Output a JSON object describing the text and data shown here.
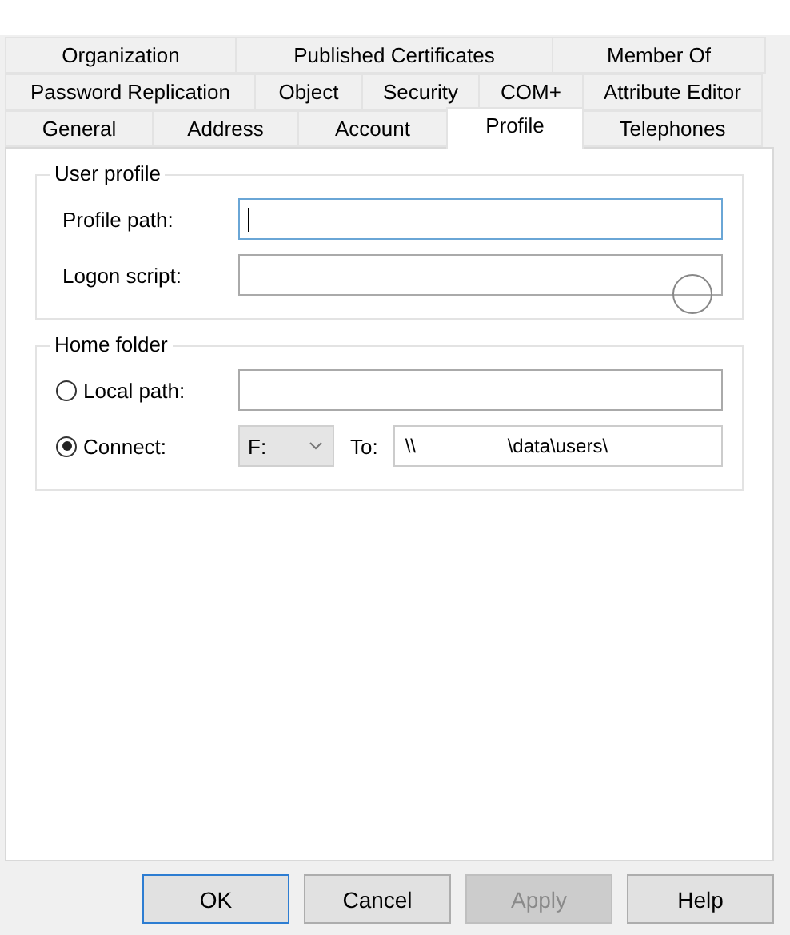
{
  "tab_rows": [
    [
      {
        "label": "Organization",
        "selected": false
      },
      {
        "label": "Published Certificates",
        "selected": false
      },
      {
        "label": "Member Of",
        "selected": false
      }
    ],
    [
      {
        "label": "Password Replication",
        "selected": false
      },
      {
        "label": "Object",
        "selected": false
      },
      {
        "label": "Security",
        "selected": false
      },
      {
        "label": "COM+",
        "selected": false
      },
      {
        "label": "Attribute Editor",
        "selected": false
      }
    ],
    [
      {
        "label": "General",
        "selected": false
      },
      {
        "label": "Address",
        "selected": false
      },
      {
        "label": "Account",
        "selected": false
      },
      {
        "label": "Profile",
        "selected": true
      },
      {
        "label": "Telephones",
        "selected": false
      }
    ]
  ],
  "user_profile": {
    "title": "User profile",
    "fields": [
      {
        "label": "Profile path:",
        "focused": true
      },
      {
        "label": "Logon script:",
        "focused": false
      }
    ]
  },
  "home_folder": {
    "title": "Home folder",
    "options": [
      {
        "label": "Local path:",
        "selected": false
      },
      {
        "label": "Connect:",
        "selected": true
      }
    ],
    "drive": "F:",
    "to_label": "To:",
    "to_value_start": "\\\\",
    "to_value_end": "\\data\\users\\"
  },
  "buttons": [
    {
      "label": "OK",
      "kind": "default",
      "disabled": false
    },
    {
      "label": "Cancel",
      "kind": "normal",
      "disabled": false
    },
    {
      "label": "Apply",
      "kind": "normal",
      "disabled": true
    },
    {
      "label": "Help",
      "kind": "normal",
      "disabled": false
    }
  ]
}
